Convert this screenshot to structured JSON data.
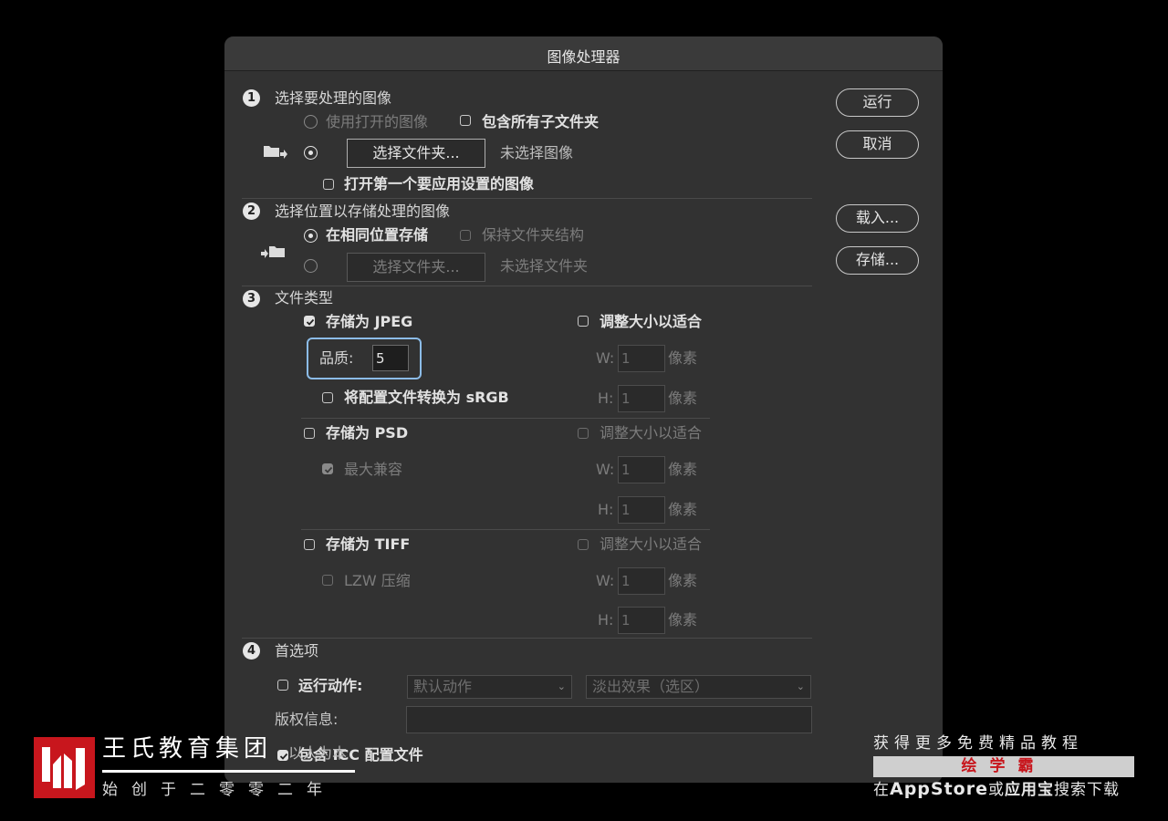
{
  "window": {
    "title": "图像处理器"
  },
  "buttons": {
    "run": "运行",
    "cancel": "取消",
    "load": "载入...",
    "save": "存储..."
  },
  "section1": {
    "number": "1",
    "title": "选择要处理的图像",
    "use_open_images": "使用打开的图像",
    "include_subfolders": "包含所有子文件夹",
    "select_folder": "选择文件夹...",
    "no_images_selected": "未选择图像",
    "open_first_image": "打开第一个要应用设置的图像"
  },
  "section2": {
    "number": "2",
    "title": "选择位置以存储处理的图像",
    "save_same_location": "在相同位置存储",
    "keep_folder_structure": "保持文件夹结构",
    "select_folder": "选择文件夹...",
    "no_folder_selected": "未选择文件夹"
  },
  "section3": {
    "number": "3",
    "title": "文件类型",
    "jpeg": {
      "save_as": "存储为 JPEG",
      "resize_to_fit": "调整大小以适合",
      "quality_label": "品质:",
      "quality_value": "5",
      "convert_srgb": "将配置文件转换为 sRGB",
      "w_label": "W:",
      "w_value": "1",
      "h_label": "H:",
      "h_value": "1",
      "unit": "像素"
    },
    "psd": {
      "save_as": "存储为 PSD",
      "resize_to_fit": "调整大小以适合",
      "max_compat": "最大兼容",
      "w_label": "W:",
      "w_value": "1",
      "h_label": "H:",
      "h_value": "1",
      "unit": "像素"
    },
    "tiff": {
      "save_as": "存储为 TIFF",
      "resize_to_fit": "调整大小以适合",
      "lzw": "LZW 压缩",
      "w_label": "W:",
      "w_value": "1",
      "h_label": "H:",
      "h_value": "1",
      "unit": "像素"
    }
  },
  "section4": {
    "number": "4",
    "title": "首选项",
    "run_action": "运行动作:",
    "action_set": "默认动作",
    "action": "淡出效果（选区）",
    "copyright": "版权信息:",
    "include_icc": "包含 ICC 配置文件"
  },
  "watermark_left": {
    "title": "王氏教育集团",
    "subtitle": "始创于二零零二年",
    "overlap": "以人为本"
  },
  "watermark_right": {
    "line1": "获得更多免费精品教程",
    "brand": "绘学霸",
    "line3_pre": "在",
    "appstore": "AppStore",
    "line3_mid": "或",
    "yyb": "应用宝",
    "line3_post": "搜索下载"
  },
  "colors": {
    "dialog_bg": "#323232",
    "focus_ring": "#8cbce8",
    "logo_red": "#c8161d",
    "brand_red": "#c8161d"
  }
}
